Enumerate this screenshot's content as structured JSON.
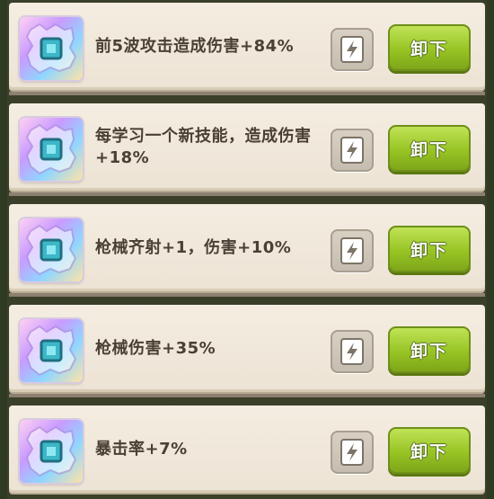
{
  "skills": [
    {
      "description": "前5波攻击造成伤害+84%",
      "unload_label": "卸下",
      "icon": "rainbow-crystal-icon",
      "lock_icon": "lightning-lock-icon"
    },
    {
      "description": "每学习一个新技能，造成伤害+18%",
      "unload_label": "卸下",
      "icon": "rainbow-crystal-icon",
      "lock_icon": "lightning-lock-icon"
    },
    {
      "description": "枪械齐射+1，伤害+10%",
      "unload_label": "卸下",
      "icon": "rainbow-crystal-icon",
      "lock_icon": "lightning-lock-icon"
    },
    {
      "description": "枪械伤害+35%",
      "unload_label": "卸下",
      "icon": "rainbow-crystal-icon",
      "lock_icon": "lightning-lock-icon"
    },
    {
      "description": "暴击率+7%",
      "unload_label": "卸下",
      "icon": "rainbow-crystal-icon",
      "lock_icon": "lightning-lock-icon"
    }
  ],
  "colors": {
    "row_bg": "#f0e8db",
    "button_green": "#97c424",
    "text": "#4b4036"
  }
}
